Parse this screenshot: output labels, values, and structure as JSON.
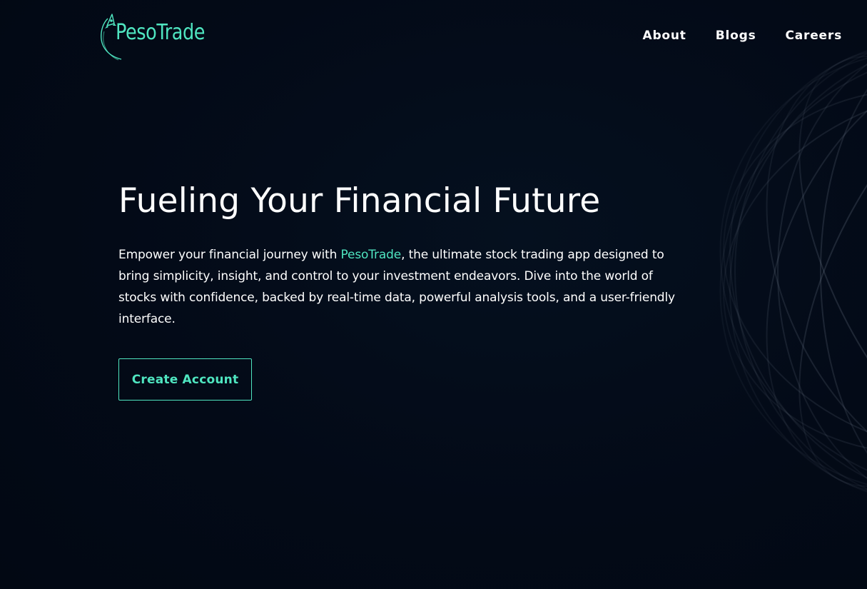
{
  "brand": {
    "name": "PesoTrade",
    "accent_color": "#4fe5c0",
    "logo_icon": "rocket-icon"
  },
  "nav": {
    "items": [
      {
        "label": "About"
      },
      {
        "label": "Blogs"
      },
      {
        "label": "Careers"
      }
    ]
  },
  "hero": {
    "title": "Fueling Your Financial Future",
    "description_before": "Empower your financial journey with ",
    "description_brand": "PesoTrade",
    "description_after": ", the ultimate stock trading app designed to bring simplicity, insight, and control to your investment endeavors. Dive into the world of stocks with confidence, backed by real-time data, powerful analysis tools, and a user-friendly interface.",
    "cta_label": "Create Account"
  },
  "theme": {
    "background": "#030a17",
    "text": "#ffffff"
  }
}
